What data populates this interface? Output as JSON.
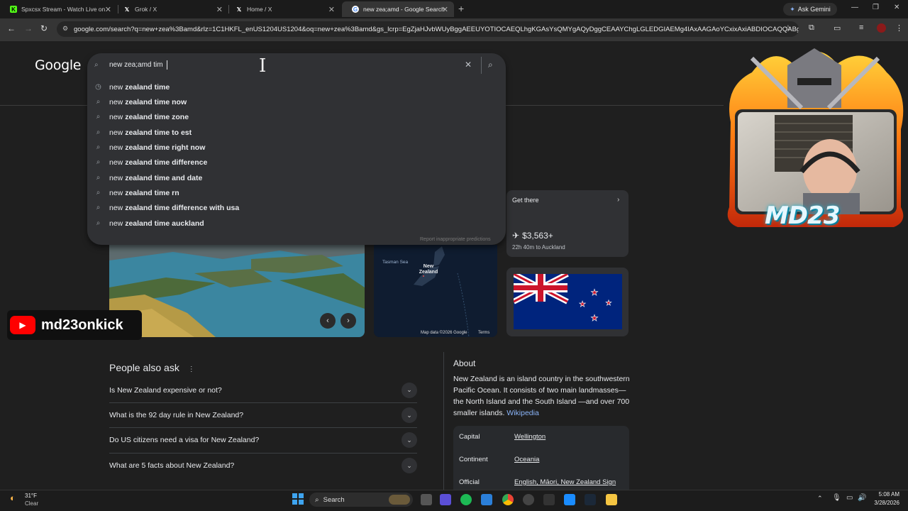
{
  "browser": {
    "tabs": [
      {
        "title": "Spxcsx Stream - Watch Live on",
        "favicon": "kick-icon",
        "color": "#53fc18"
      },
      {
        "title": "Grok / X",
        "favicon": "x-icon",
        "color": "#ffffff"
      },
      {
        "title": "Home / X",
        "favicon": "x-icon",
        "color": "#ffffff"
      },
      {
        "title": "new zea;amd - Google Search",
        "favicon": "google-icon",
        "color": "#ffffff"
      }
    ],
    "new_tab": "+",
    "ask_gemini": "Ask Gemini",
    "url": "google.com/search?q=new+zea%3Bamd&rlz=1C1HKFL_enUS1204US1204&oq=new+zea%3Bamd&gs_lcrp=EgZjaHJvbWUyBggAEEUYOTIOCAEQLhgKGAsYsQMYgAQyDggCEAAYChgLGLEDGIAEMg4IAxAAGAoYCxixAxiABDIOCAQQABgKGAsYs..."
  },
  "google": {
    "logo": "Google",
    "query": "new zea;amd tim",
    "suggestions": [
      {
        "prefix": "new ",
        "bold": "zealand time",
        "suffix": "",
        "icon": "history-icon"
      },
      {
        "prefix": "new ",
        "bold": "zealand time now",
        "suffix": "",
        "icon": "search-icon"
      },
      {
        "prefix": "new ",
        "bold": "zealand time zone",
        "suffix": "",
        "icon": "search-icon"
      },
      {
        "prefix": "new ",
        "bold": "zealand time to est",
        "suffix": "",
        "icon": "search-icon"
      },
      {
        "prefix": "new ",
        "bold": "zealand time right now",
        "suffix": "",
        "icon": "search-icon"
      },
      {
        "prefix": "new ",
        "bold": "zealand time difference",
        "suffix": "",
        "icon": "search-icon"
      },
      {
        "prefix": "new ",
        "bold": "zealand time and date",
        "suffix": "",
        "icon": "search-icon"
      },
      {
        "prefix": "new ",
        "bold": "zealand time rn",
        "suffix": "",
        "icon": "search-icon"
      },
      {
        "prefix": "new ",
        "bold": "zealand time difference with usa",
        "suffix": "",
        "icon": "search-icon"
      },
      {
        "prefix": "new ",
        "bold": "zealand time auckland",
        "suffix": "",
        "icon": "search-icon"
      }
    ],
    "report": "Report inappropriate predictions"
  },
  "cards": {
    "get_there": "Get there",
    "price": "$3,563+",
    "duration": "22h 40m to Auckland",
    "map_sea": "Tasman Sea",
    "map_country": "New Zealand",
    "map_credit": "Map data ©2026 Google",
    "map_terms": "Terms"
  },
  "paa": {
    "title": "People also ask",
    "questions": [
      "Is New Zealand expensive or not?",
      "What is the 92 day rule in New Zealand?",
      "Do US citizens need a visa for New Zealand?",
      "What are 5 facts about New Zealand?"
    ]
  },
  "about": {
    "title": "About",
    "text": "New Zealand is an island country in the southwestern Pacific Ocean. It consists of two main landmasses—the North Island and the South Island —and over 700 smaller islands.",
    "link": "Wikipedia",
    "facts": [
      {
        "key": "Capital",
        "value": "Wellington"
      },
      {
        "key": "Continent",
        "value": "Oceania"
      },
      {
        "key": "Official",
        "value": "English, Māori, New Zealand Sign"
      }
    ]
  },
  "overlay": {
    "streamer_logo": "MD23",
    "youtube_handle": "md23onkick"
  },
  "taskbar": {
    "weather_temp": "31°F",
    "weather_desc": "Clear",
    "search": "Search",
    "time": "5:08 AM",
    "date": "3/28/2026"
  }
}
